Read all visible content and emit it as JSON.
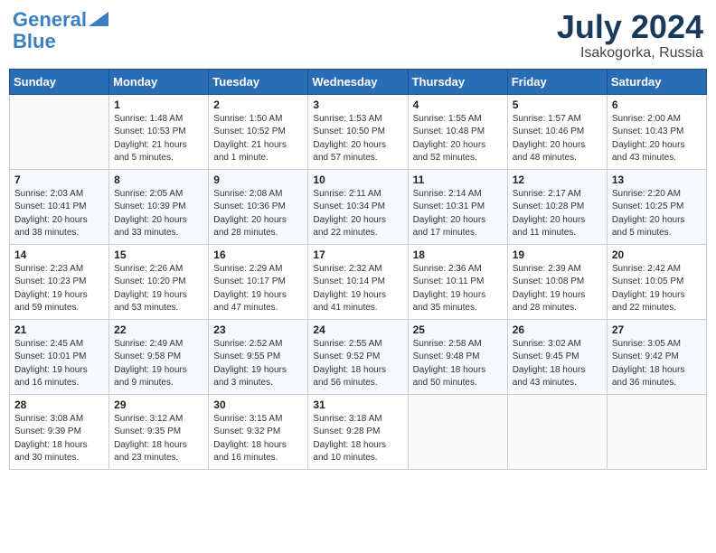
{
  "header": {
    "logo_line1": "General",
    "logo_line2": "Blue",
    "month_year": "July 2024",
    "location": "Isakogorka, Russia"
  },
  "weekdays": [
    "Sunday",
    "Monday",
    "Tuesday",
    "Wednesday",
    "Thursday",
    "Friday",
    "Saturday"
  ],
  "weeks": [
    [
      {
        "day": "",
        "info": ""
      },
      {
        "day": "1",
        "info": "Sunrise: 1:48 AM\nSunset: 10:53 PM\nDaylight: 21 hours\nand 5 minutes."
      },
      {
        "day": "2",
        "info": "Sunrise: 1:50 AM\nSunset: 10:52 PM\nDaylight: 21 hours\nand 1 minute."
      },
      {
        "day": "3",
        "info": "Sunrise: 1:53 AM\nSunset: 10:50 PM\nDaylight: 20 hours\nand 57 minutes."
      },
      {
        "day": "4",
        "info": "Sunrise: 1:55 AM\nSunset: 10:48 PM\nDaylight: 20 hours\nand 52 minutes."
      },
      {
        "day": "5",
        "info": "Sunrise: 1:57 AM\nSunset: 10:46 PM\nDaylight: 20 hours\nand 48 minutes."
      },
      {
        "day": "6",
        "info": "Sunrise: 2:00 AM\nSunset: 10:43 PM\nDaylight: 20 hours\nand 43 minutes."
      }
    ],
    [
      {
        "day": "7",
        "info": "Sunrise: 2:03 AM\nSunset: 10:41 PM\nDaylight: 20 hours\nand 38 minutes."
      },
      {
        "day": "8",
        "info": "Sunrise: 2:05 AM\nSunset: 10:39 PM\nDaylight: 20 hours\nand 33 minutes."
      },
      {
        "day": "9",
        "info": "Sunrise: 2:08 AM\nSunset: 10:36 PM\nDaylight: 20 hours\nand 28 minutes."
      },
      {
        "day": "10",
        "info": "Sunrise: 2:11 AM\nSunset: 10:34 PM\nDaylight: 20 hours\nand 22 minutes."
      },
      {
        "day": "11",
        "info": "Sunrise: 2:14 AM\nSunset: 10:31 PM\nDaylight: 20 hours\nand 17 minutes."
      },
      {
        "day": "12",
        "info": "Sunrise: 2:17 AM\nSunset: 10:28 PM\nDaylight: 20 hours\nand 11 minutes."
      },
      {
        "day": "13",
        "info": "Sunrise: 2:20 AM\nSunset: 10:25 PM\nDaylight: 20 hours\nand 5 minutes."
      }
    ],
    [
      {
        "day": "14",
        "info": "Sunrise: 2:23 AM\nSunset: 10:23 PM\nDaylight: 19 hours\nand 59 minutes."
      },
      {
        "day": "15",
        "info": "Sunrise: 2:26 AM\nSunset: 10:20 PM\nDaylight: 19 hours\nand 53 minutes."
      },
      {
        "day": "16",
        "info": "Sunrise: 2:29 AM\nSunset: 10:17 PM\nDaylight: 19 hours\nand 47 minutes."
      },
      {
        "day": "17",
        "info": "Sunrise: 2:32 AM\nSunset: 10:14 PM\nDaylight: 19 hours\nand 41 minutes."
      },
      {
        "day": "18",
        "info": "Sunrise: 2:36 AM\nSunset: 10:11 PM\nDaylight: 19 hours\nand 35 minutes."
      },
      {
        "day": "19",
        "info": "Sunrise: 2:39 AM\nSunset: 10:08 PM\nDaylight: 19 hours\nand 28 minutes."
      },
      {
        "day": "20",
        "info": "Sunrise: 2:42 AM\nSunset: 10:05 PM\nDaylight: 19 hours\nand 22 minutes."
      }
    ],
    [
      {
        "day": "21",
        "info": "Sunrise: 2:45 AM\nSunset: 10:01 PM\nDaylight: 19 hours\nand 16 minutes."
      },
      {
        "day": "22",
        "info": "Sunrise: 2:49 AM\nSunset: 9:58 PM\nDaylight: 19 hours\nand 9 minutes."
      },
      {
        "day": "23",
        "info": "Sunrise: 2:52 AM\nSunset: 9:55 PM\nDaylight: 19 hours\nand 3 minutes."
      },
      {
        "day": "24",
        "info": "Sunrise: 2:55 AM\nSunset: 9:52 PM\nDaylight: 18 hours\nand 56 minutes."
      },
      {
        "day": "25",
        "info": "Sunrise: 2:58 AM\nSunset: 9:48 PM\nDaylight: 18 hours\nand 50 minutes."
      },
      {
        "day": "26",
        "info": "Sunrise: 3:02 AM\nSunset: 9:45 PM\nDaylight: 18 hours\nand 43 minutes."
      },
      {
        "day": "27",
        "info": "Sunrise: 3:05 AM\nSunset: 9:42 PM\nDaylight: 18 hours\nand 36 minutes."
      }
    ],
    [
      {
        "day": "28",
        "info": "Sunrise: 3:08 AM\nSunset: 9:39 PM\nDaylight: 18 hours\nand 30 minutes."
      },
      {
        "day": "29",
        "info": "Sunrise: 3:12 AM\nSunset: 9:35 PM\nDaylight: 18 hours\nand 23 minutes."
      },
      {
        "day": "30",
        "info": "Sunrise: 3:15 AM\nSunset: 9:32 PM\nDaylight: 18 hours\nand 16 minutes."
      },
      {
        "day": "31",
        "info": "Sunrise: 3:18 AM\nSunset: 9:28 PM\nDaylight: 18 hours\nand 10 minutes."
      },
      {
        "day": "",
        "info": ""
      },
      {
        "day": "",
        "info": ""
      },
      {
        "day": "",
        "info": ""
      }
    ]
  ]
}
